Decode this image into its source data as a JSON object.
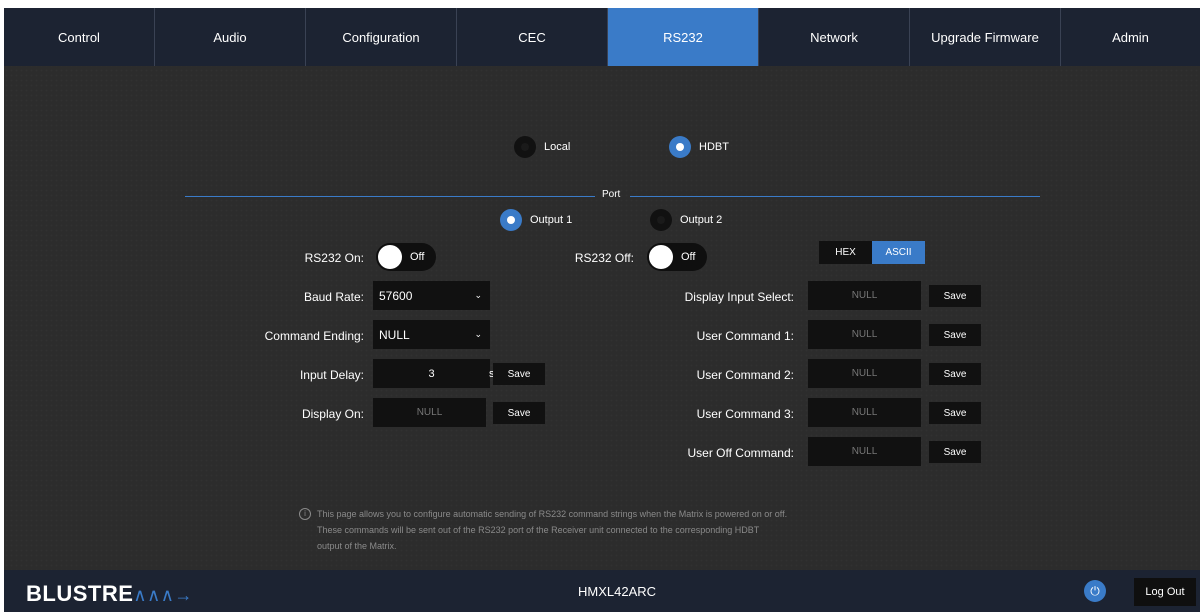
{
  "tabs": [
    {
      "label": "Control"
    },
    {
      "label": "Audio"
    },
    {
      "label": "Configuration"
    },
    {
      "label": "CEC"
    },
    {
      "label": "RS232",
      "active": true
    },
    {
      "label": "Network"
    },
    {
      "label": "Upgrade Firmware"
    },
    {
      "label": "Admin"
    }
  ],
  "source": {
    "local_label": "Local",
    "hdbt_label": "HDBT",
    "selected": "HDBT"
  },
  "port": {
    "label": "Port",
    "output1_label": "Output 1",
    "output2_label": "Output 2",
    "selected": "Output 1"
  },
  "left_form": {
    "rs232_on_label": "RS232 On:",
    "rs232_on_value": "Off",
    "baud_rate_label": "Baud Rate:",
    "baud_rate_value": "57600",
    "command_ending_label": "Command Ending:",
    "command_ending_value": "NULL",
    "input_delay_label": "Input Delay:",
    "input_delay_value": "3",
    "input_delay_unit": "s",
    "display_on_label": "Display On:",
    "display_on_placeholder": "NULL",
    "save_label": "Save"
  },
  "right_form": {
    "rs232_off_label": "RS232 Off:",
    "rs232_off_value": "Off",
    "hex_label": "HEX",
    "ascii_label": "ASCII",
    "format_selected": "ASCII",
    "display_input_select_label": "Display Input Select:",
    "user_command_1_label": "User Command 1:",
    "user_command_2_label": "User Command 2:",
    "user_command_3_label": "User Command 3:",
    "user_off_command_label": "User Off Command:",
    "placeholder": "NULL",
    "save_label": "Save"
  },
  "info": {
    "icon_glyph": "i",
    "line1": "This page allows you to configure automatic sending of RS232 command strings when the Matrix is powered on or off.",
    "line2": "These commands will be sent out of the RS232 port of the Receiver unit connected to the corresponding HDBT",
    "line3": "output of the Matrix."
  },
  "footer": {
    "logo_text": "BLUSTRE",
    "logo_wave": "∧∧∧→",
    "device_name": "HMXL42ARC",
    "power_icon": "power-icon",
    "logout_label": "Log Out"
  },
  "colors": {
    "accent": "#3a7bc8",
    "nav_bg": "#1c2332",
    "page_bg": "#2c2c2c",
    "field_bg": "#111111"
  }
}
